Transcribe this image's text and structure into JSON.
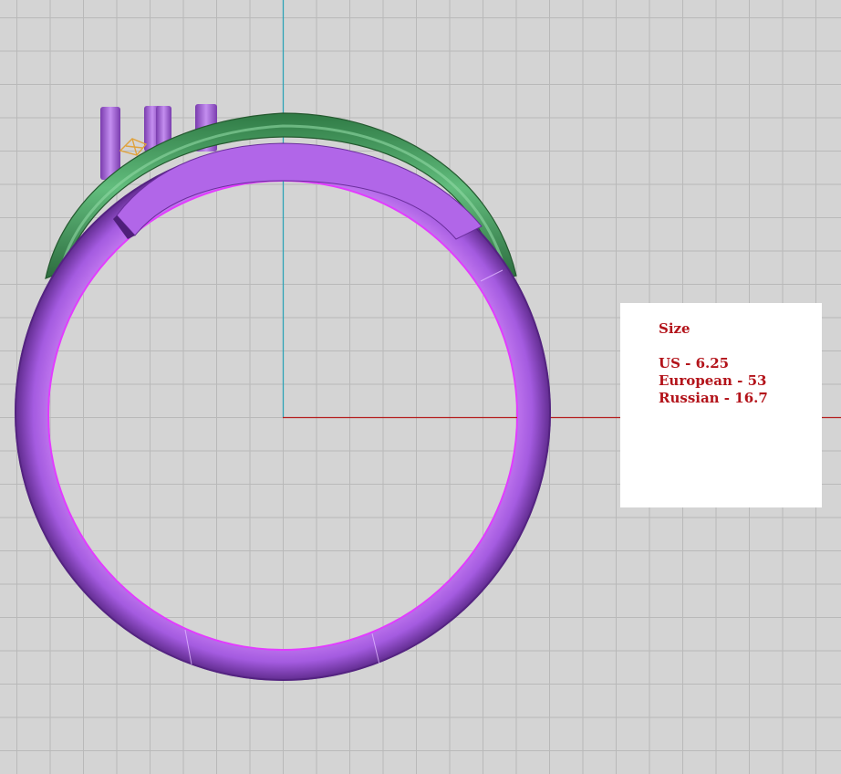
{
  "size_panel": {
    "title": "Size",
    "rows": [
      "US - 6.25",
      "European - 53",
      "Russian - 16.7"
    ]
  },
  "colors": {
    "background": "#d4d4d4",
    "grid_line": "#b9b9b9",
    "y_axis": "#2fa3b6",
    "x_axis": "#b51d1d",
    "ring_band": "#9b4fd6",
    "ring_inner_edge": "#e23cff",
    "crown_arc": "#3f9a5c",
    "prongs": "#a15ad8",
    "gem_setting": "#e0a23c",
    "panel_text": "#b3131a",
    "panel_bg": "#ffffff"
  }
}
